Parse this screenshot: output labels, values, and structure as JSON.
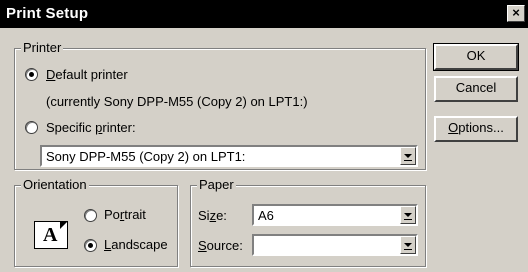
{
  "window": {
    "title": "Print Setup",
    "close_glyph": "×"
  },
  "printer_group": {
    "legend": "Printer",
    "default_label": "Default printer",
    "default_checked": true,
    "current_note": "(currently Sony DPP-M55 (Copy 2) on LPT1:)",
    "specific_label": "Specific printer:",
    "specific_checked": false,
    "printer_select_value": "Sony DPP-M55 (Copy 2) on LPT1:"
  },
  "orientation_group": {
    "legend": "Orientation",
    "portrait_label": "Portrait",
    "landscape_label": "Landscape",
    "selected": "Landscape",
    "icon_letter": "A"
  },
  "paper_group": {
    "legend": "Paper",
    "size_label": "Size:",
    "size_value": "A6",
    "source_label": "Source:",
    "source_value": ""
  },
  "buttons": {
    "ok": "OK",
    "cancel": "Cancel",
    "options": "Options..."
  }
}
